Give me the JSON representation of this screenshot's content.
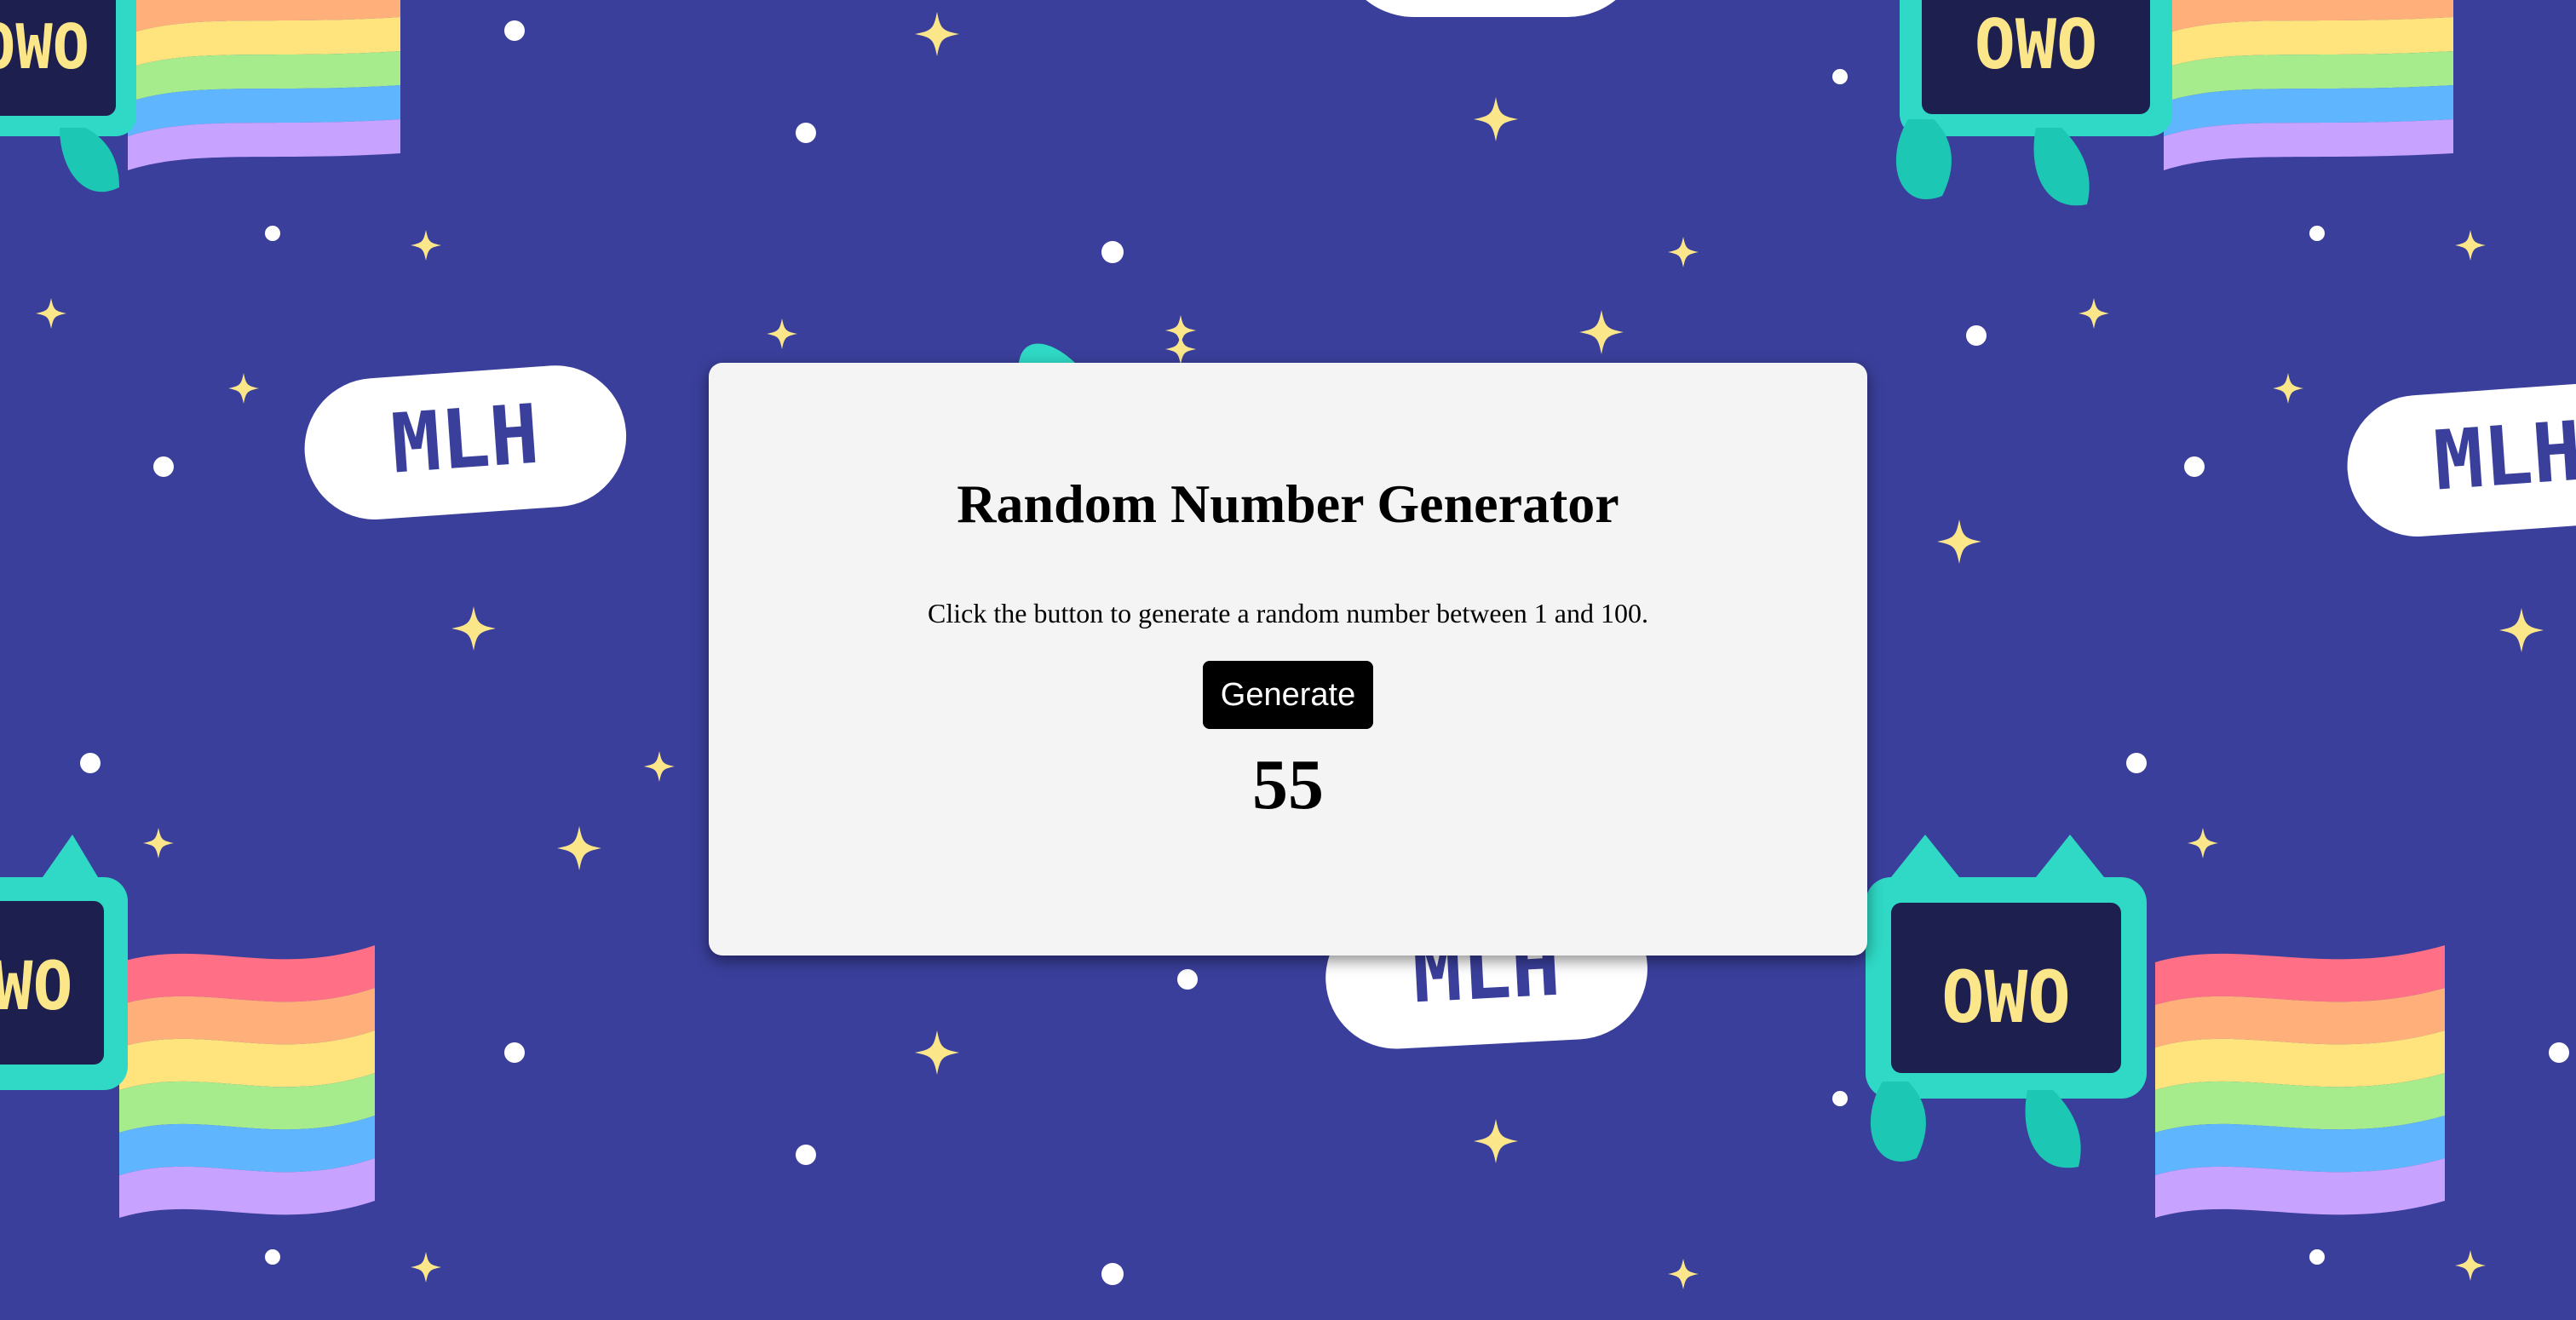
{
  "card": {
    "title": "Random Number Generator",
    "description": "Click the button to generate a random number between 1 and 100.",
    "button_label": "Generate",
    "result": "55"
  },
  "background": {
    "badge_text": "MLH",
    "screen_text": "OWO",
    "colors": {
      "sky": "#3a3f9b",
      "star": "#fce68a",
      "robot_body": "#2fd9c5",
      "robot_screen": "#1d1f4f",
      "badge": "#ffffff",
      "badge_text": "#3a3f9b",
      "card": "#f4f4f4",
      "button": "#000000"
    },
    "rainbow": [
      "#ff6f86",
      "#ffb07a",
      "#ffe37c",
      "#a6ec8d",
      "#5fb6ff",
      "#c7a2ff"
    ]
  }
}
